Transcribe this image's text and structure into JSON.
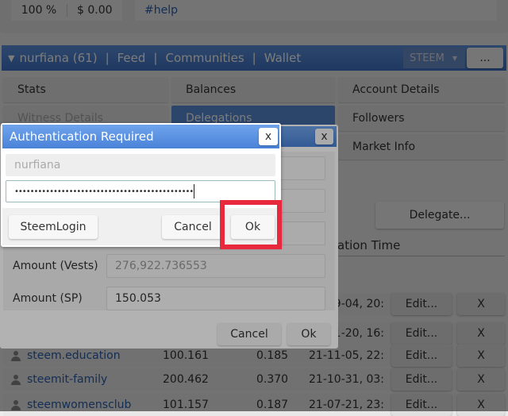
{
  "top": {
    "vote_pct": "100 %",
    "value": "$ 0.00",
    "tag": "#help"
  },
  "nav": {
    "user": "nurfiana (61)",
    "links": [
      "Feed",
      "Communities",
      "Wallet"
    ],
    "currency": "STEEM",
    "more": "..."
  },
  "tabs": [
    "Stats",
    "Balances",
    "Account Details",
    "Witness Details",
    "Delegations",
    "Followers",
    "Market Info"
  ],
  "main": {
    "delegate_button": "Delegate...",
    "col_time": "ation Time",
    "rows": [
      {
        "name": "",
        "vests": "",
        "sp": "",
        "time": "09-04, 20:",
        "edit": "Edit...",
        "x": "X"
      },
      {
        "name": "",
        "vests": "",
        "sp": "",
        "time": "11-20, 16:",
        "edit": "Edit...",
        "x": "X"
      },
      {
        "name": "steem.education",
        "vests": "100.161",
        "sp": "0.185",
        "time": "2021-11-05, 22:",
        "edit": "Edit...",
        "x": "X"
      },
      {
        "name": "steemit-family",
        "vests": "200.462",
        "sp": "0.370",
        "time": "2021-10-31, 03:",
        "edit": "Edit...",
        "x": "X"
      },
      {
        "name": "steemwomensclub",
        "vests": "101.157",
        "sp": "0.187",
        "time": "2021-07-21, 23:",
        "edit": "Edit...",
        "x": "X"
      }
    ]
  },
  "delegate_dialog": {
    "close": "x",
    "amount_vests_label": "Amount (Vests)",
    "amount_vests": "276,922.736553",
    "amount_sp_label": "Amount (SP)",
    "amount_sp": "150.053",
    "cancel": "Cancel",
    "ok": "Ok"
  },
  "auth_dialog": {
    "title": "Authentication Required",
    "close": "x",
    "username": "nurfiana",
    "password": "••••••••••••••••••••••••••••••••••••••••••••••",
    "steemlogin": "SteemLogin",
    "cancel": "Cancel",
    "ok": "Ok"
  },
  "colors": {
    "accent": "#4a82d8",
    "highlight": "#e8283c"
  }
}
